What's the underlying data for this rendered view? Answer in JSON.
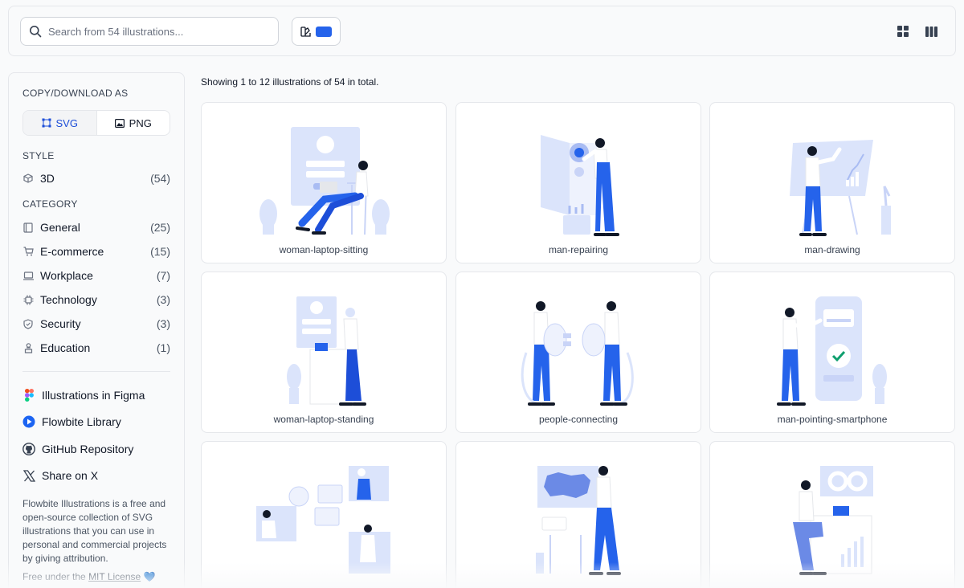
{
  "search": {
    "placeholder": "Search from 54 illustrations..."
  },
  "color_picker": {
    "selected_color": "#2563eb"
  },
  "sidebar": {
    "copy_title": "COPY/DOWNLOAD AS",
    "formats": [
      {
        "label": "SVG",
        "active": true
      },
      {
        "label": "PNG",
        "active": false
      }
    ],
    "style_title": "STYLE",
    "styles": [
      {
        "label": "3D",
        "count": "(54)",
        "icon": "cube-icon"
      }
    ],
    "category_title": "CATEGORY",
    "categories": [
      {
        "label": "General",
        "count": "(25)",
        "icon": "book-icon"
      },
      {
        "label": "E-commerce",
        "count": "(15)",
        "icon": "cart-icon"
      },
      {
        "label": "Workplace",
        "count": "(7)",
        "icon": "laptop-icon"
      },
      {
        "label": "Technology",
        "count": "(3)",
        "icon": "chip-icon"
      },
      {
        "label": "Security",
        "count": "(3)",
        "icon": "shield-icon"
      },
      {
        "label": "Education",
        "count": "(1)",
        "icon": "graduation-icon"
      }
    ],
    "links": [
      {
        "label": "Illustrations in Figma",
        "icon": "figma-icon"
      },
      {
        "label": "Flowbite Library",
        "icon": "flowbite-icon"
      },
      {
        "label": "GitHub Repository",
        "icon": "github-icon"
      },
      {
        "label": "Share on X",
        "icon": "x-icon"
      }
    ],
    "description": "Flowbite Illustrations is a free and open-source collection of SVG illustrations that you can use in personal and commercial projects by giving attribution.",
    "license_prefix": "Free under the ",
    "license_link": "MIT License",
    "license_suffix": " 💙"
  },
  "main": {
    "showing_text": "Showing 1 to 12 illustrations of 54 in total.",
    "cards": [
      {
        "name": "woman-laptop-sitting"
      },
      {
        "name": "man-repairing"
      },
      {
        "name": "man-drawing"
      },
      {
        "name": "woman-laptop-standing"
      },
      {
        "name": "people-connecting"
      },
      {
        "name": "man-pointing-smartphone"
      },
      {
        "name": ""
      },
      {
        "name": ""
      },
      {
        "name": ""
      }
    ]
  },
  "colors": {
    "accent": "#2563eb",
    "light_blue": "#dbe4fb",
    "mid_blue": "#a9bcf3"
  }
}
